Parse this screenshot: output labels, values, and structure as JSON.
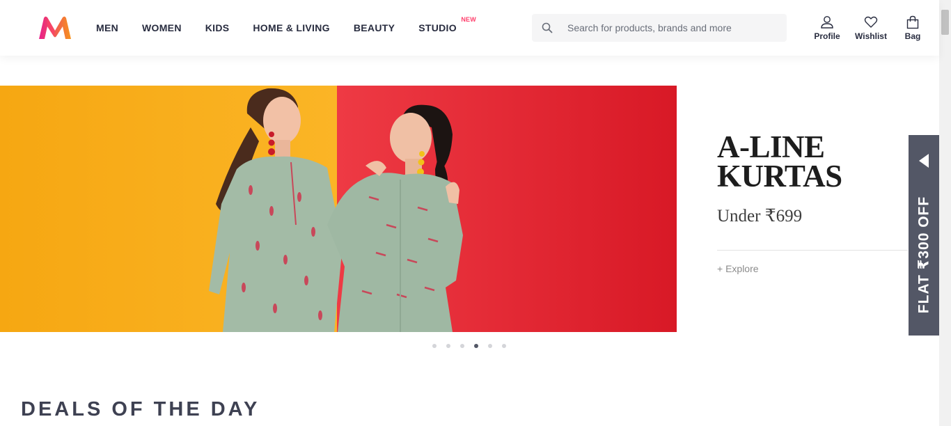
{
  "brand": {
    "logo_icon": "myntra-logo",
    "colors": {
      "pink": "#ff3f6c",
      "orange": "#f7941d",
      "dark": "#282c3f"
    }
  },
  "nav": {
    "items": [
      {
        "label": "MEN"
      },
      {
        "label": "WOMEN"
      },
      {
        "label": "KIDS"
      },
      {
        "label": "HOME & LIVING"
      },
      {
        "label": "BEAUTY"
      },
      {
        "label": "STUDIO",
        "tag": "NEW"
      }
    ]
  },
  "search": {
    "placeholder": "Search for products, brands and more",
    "icon": "search-icon"
  },
  "actions": {
    "profile": {
      "label": "Profile",
      "icon": "profile-icon"
    },
    "wishlist": {
      "label": "Wishlist",
      "icon": "heart-icon"
    },
    "bag": {
      "label": "Bag",
      "icon": "bag-icon"
    }
  },
  "banner": {
    "title": "A-LINE\nKURTAS",
    "price": "Under ₹699",
    "explore": "+ Explore",
    "colors": {
      "left_bg": "#f5a817",
      "right_bg": "#e4202f",
      "kurta": "#9fb8a3"
    }
  },
  "carousel": {
    "total": 6,
    "active": 4
  },
  "offer_tab": {
    "text": "FLAT ₹300 OFF",
    "icon": "arrow-left-icon"
  },
  "deals": {
    "title": "DEALS OF THE DAY"
  }
}
